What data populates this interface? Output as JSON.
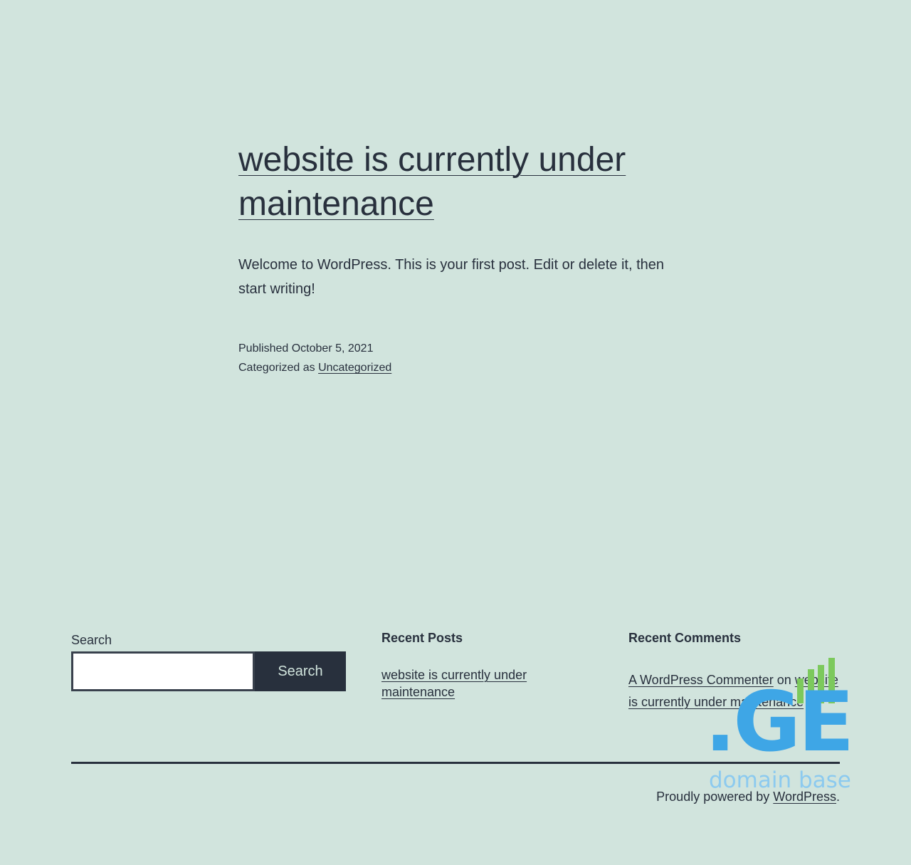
{
  "post": {
    "title": "website is currently under maintenance",
    "content": "Welcome to WordPress. This is your first post. Edit or delete it, then start writing!",
    "published_label": "Published",
    "published_date": "October 5, 2021",
    "category_label": "Categorized as",
    "category": "Uncategorized"
  },
  "footer": {
    "search": {
      "label": "Search",
      "input_value": "",
      "button_label": "Search"
    },
    "recent_posts": {
      "title": "Recent Posts",
      "items": [
        {
          "label": "website is currently under maintenance"
        }
      ]
    },
    "recent_comments": {
      "title": "Recent Comments",
      "items": [
        {
          "author": "A WordPress Commenter",
          "connector": "on",
          "post": "website is currently under maintenance"
        }
      ]
    },
    "powered_by_prefix": "Proudly powered by",
    "powered_by_link": "WordPress",
    "powered_by_suffix": "."
  },
  "watermark": {
    "logo_text": ".GE",
    "tagline": "domain base",
    "colors": {
      "blue": "#3ea6e6",
      "light_blue": "#8ccaef",
      "green": "#7cc95c"
    }
  },
  "colors": {
    "background": "#d1e4dd",
    "text": "#28303d"
  }
}
